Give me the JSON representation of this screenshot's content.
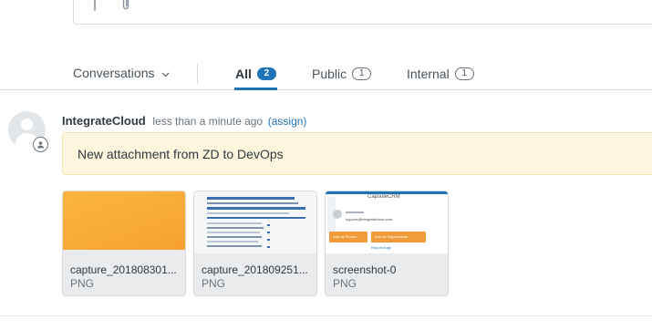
{
  "composer": {
    "text_icon": "text-format-icon",
    "attach_icon": "paperclip-icon"
  },
  "tabs": {
    "conversations_label": "Conversations",
    "all_label": "All",
    "all_count": "2",
    "public_label": "Public",
    "public_count": "1",
    "internal_label": "Internal",
    "internal_count": "1",
    "active": "All"
  },
  "event": {
    "author": "IntegrateCloud",
    "time": "less than a minute ago",
    "assign_label": "(assign)",
    "message": "New attachment from ZD to DevOps"
  },
  "attachments": [
    {
      "name": "capture_201808301...",
      "type": "PNG"
    },
    {
      "name": "capture_201809251...",
      "type": "PNG"
    },
    {
      "name": "screenshot-0",
      "type": "PNG"
    }
  ],
  "thumb3": {
    "app_name": "CapsuleCRM",
    "email": "support@integratecloud.com",
    "person_button": "Add as Person",
    "org_button": "Add as Organization",
    "report_link": "Report bugs"
  },
  "colors": {
    "accent": "#1f73b7",
    "message_bg": "#fdf6dc",
    "thumb_orange": "#f8a936"
  }
}
